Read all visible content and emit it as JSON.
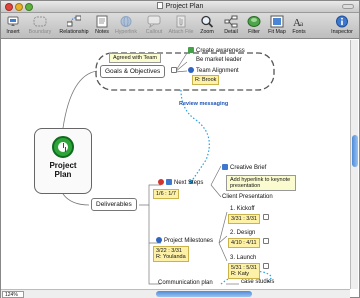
{
  "window": {
    "title": "Project Plan"
  },
  "toolbar": {
    "insert": "Insert",
    "boundary": "Boundary",
    "relationship": "Relationship",
    "notes": "Notes",
    "hyperlink": "Hyperlink",
    "callout": "Callout",
    "attach_file": "Attach File",
    "zoom": "Zoom",
    "detail": "Detail",
    "filter": "Filter",
    "fit_map": "Fit Map",
    "fonts": "Fonts",
    "inspector": "Inspector"
  },
  "map": {
    "central": {
      "title_line1": "Project",
      "title_line2": "Plan"
    },
    "goals": {
      "label": "Goals & Objectives",
      "callout": "Agreed with Team",
      "children": [
        "Create awareness",
        "Be market leader",
        "Team Alignment"
      ],
      "resource": "R: Brook",
      "relationship_label": "Review messaging"
    },
    "deliverables": {
      "label": "Deliverables",
      "next_steps": {
        "label": "Next Steps",
        "dates": "1/6 : 1/7",
        "children": [
          "Creative Brief",
          "Client Presentation"
        ],
        "callout": "Add hyperlink to keynote presentation"
      },
      "milestones": {
        "label": "Project Milestones",
        "dates": "3/22 : 3/31",
        "resource": "R: Youlanda",
        "items": [
          {
            "label": "1. Kickoff",
            "dates": "3/31 : 3/31"
          },
          {
            "label": "2. Design",
            "dates": "4/10 : 4/11"
          },
          {
            "label": "3. Launch",
            "dates": "5/31 : 5/31",
            "resource": "R: Katy"
          }
        ]
      },
      "communication": {
        "label": "Communication plan",
        "child": "case studies"
      }
    }
  },
  "status": {
    "zoom": "124%"
  },
  "colors": {
    "accent_blue": "#2155b8",
    "note_yellow": "#fdf1a8",
    "central_green": "#2fa43b"
  }
}
